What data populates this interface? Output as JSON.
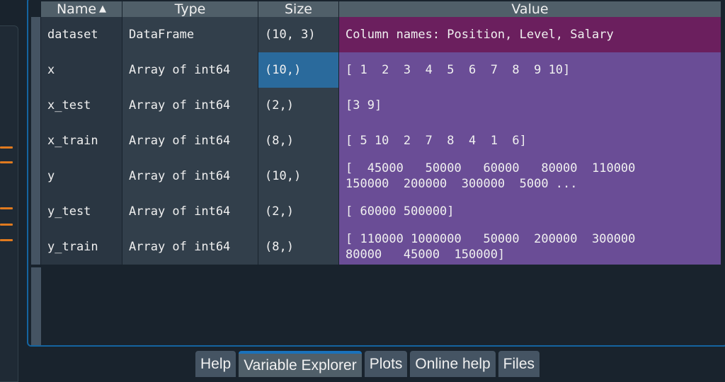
{
  "header": {
    "name": "Name",
    "type": "Type",
    "size": "Size",
    "value": "Value",
    "sort_icon": "sort-ascending-icon"
  },
  "rows": [
    {
      "name": "dataset",
      "type": "DataFrame",
      "size": "(10, 3)",
      "value": "Column names: Position, Level, Salary"
    },
    {
      "name": "x",
      "type": "Array of int64",
      "size": "(10,)",
      "value": "[ 1  2  3  4  5  6  7  8  9 10]"
    },
    {
      "name": "x_test",
      "type": "Array of int64",
      "size": "(2,)",
      "value": "[3 9]"
    },
    {
      "name": "x_train",
      "type": "Array of int64",
      "size": "(8,)",
      "value": "[ 5 10  2  7  8  4  1  6]"
    },
    {
      "name": "y",
      "type": "Array of int64",
      "size": "(10,)",
      "value": "[  45000   50000   60000   80000  110000\n150000  200000  300000  5000 ..."
    },
    {
      "name": "y_test",
      "type": "Array of int64",
      "size": "(2,)",
      "value": "[ 60000 500000]"
    },
    {
      "name": "y_train",
      "type": "Array of int64",
      "size": "(8,)",
      "value": "[ 110000 1000000   50000  200000  300000\n80000   45000  150000]"
    }
  ],
  "tabs": [
    {
      "label": "Help",
      "active": false
    },
    {
      "label": "Variable Explorer",
      "active": true
    },
    {
      "label": "Plots",
      "active": false
    },
    {
      "label": "Online help",
      "active": false
    },
    {
      "label": "Files",
      "active": false
    }
  ],
  "colors": {
    "accent": "#1464a0",
    "dataframe_value": "#6b1f5e",
    "array_value": "#6a4d96",
    "selected_cell": "#2a6a9c",
    "editor_marker": "#e07a1f"
  }
}
